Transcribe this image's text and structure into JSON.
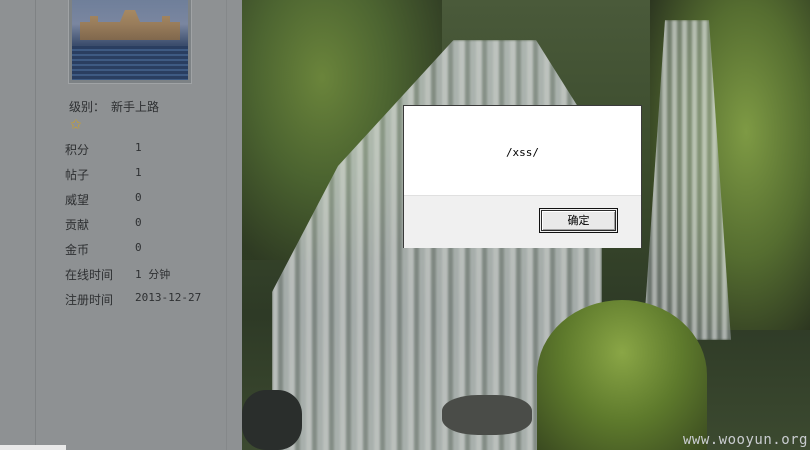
{
  "profile": {
    "level_label": "级别：",
    "level_value": "新手上路",
    "star_icon": "star-icon",
    "stats": [
      {
        "key": "积分",
        "value": "1"
      },
      {
        "key": "帖子",
        "value": "1"
      },
      {
        "key": "威望",
        "value": "0"
      },
      {
        "key": "贡献",
        "value": "0"
      },
      {
        "key": "金币",
        "value": "0"
      },
      {
        "key": "在线时间",
        "value": "1 分钟"
      },
      {
        "key": "注册时间",
        "value": "2013-12-27"
      }
    ]
  },
  "dialog": {
    "message": "/xss/",
    "ok_label": "确定"
  },
  "watermark": "www.wooyun.org"
}
